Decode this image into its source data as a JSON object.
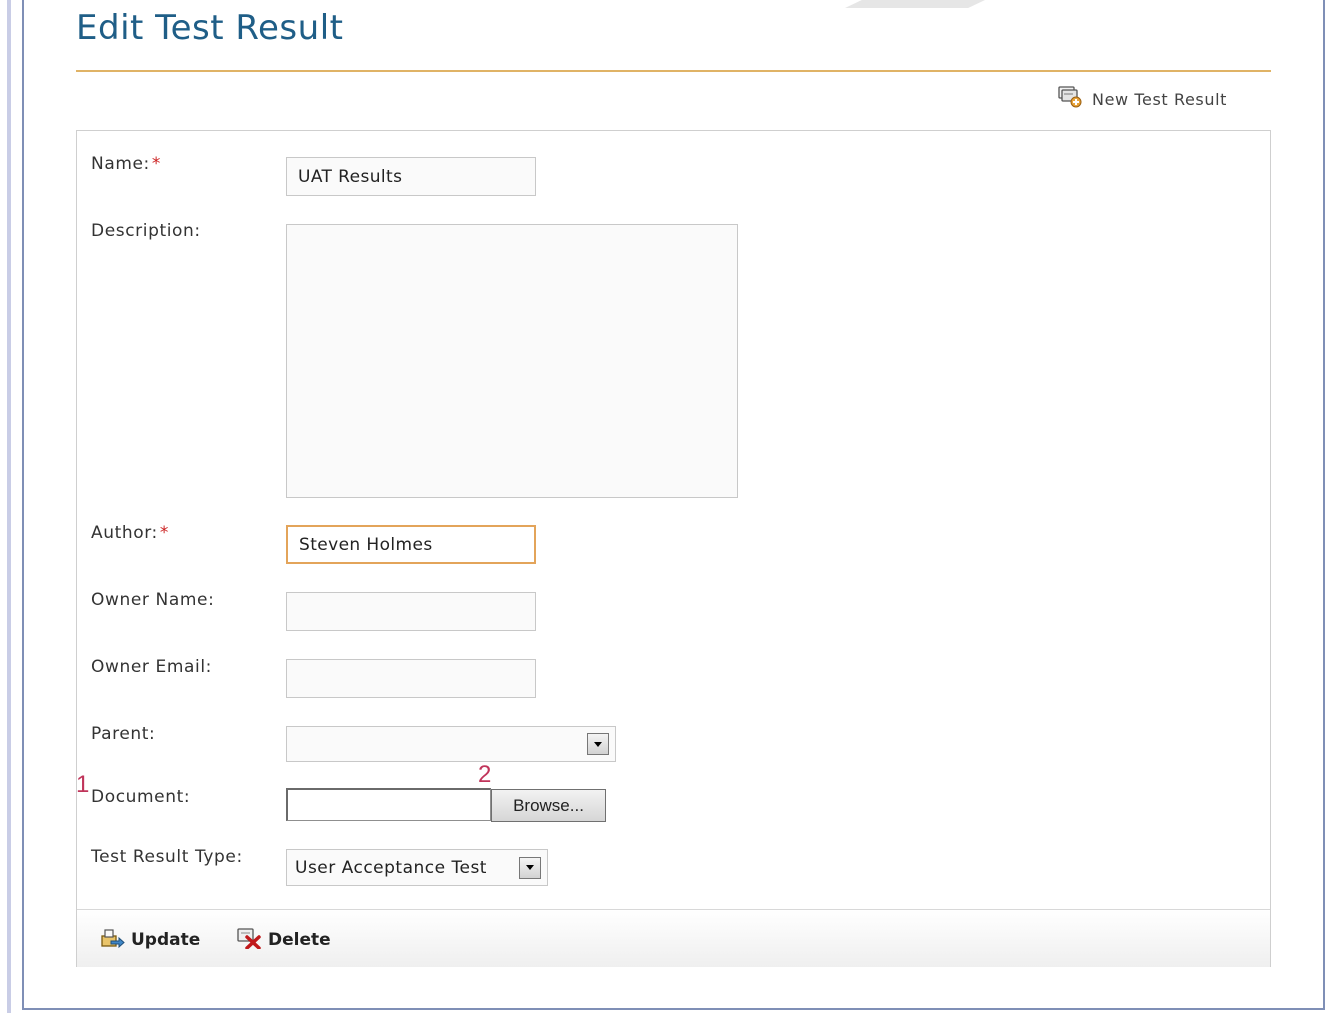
{
  "page": {
    "title": "Edit Test Result"
  },
  "header_actions": {
    "new_label": "New Test Result",
    "new_icon": "new-record-icon"
  },
  "form": {
    "name": {
      "label": "Name:",
      "required_mark": "*",
      "value": "UAT Results"
    },
    "description": {
      "label": "Description:",
      "value": ""
    },
    "author": {
      "label": "Author:",
      "required_mark": "*",
      "value": "Steven Holmes"
    },
    "owner_name": {
      "label": "Owner Name:",
      "value": ""
    },
    "owner_email": {
      "label": "Owner Email:",
      "value": ""
    },
    "parent": {
      "label": "Parent:",
      "selected": ""
    },
    "document": {
      "label": "Document:",
      "browse_label": "Browse...",
      "marker_1": "1",
      "marker_2": "2"
    },
    "test_result_type": {
      "label": "Test Result Type:",
      "selected": "User Acceptance Test"
    }
  },
  "footer": {
    "update_label": "Update",
    "update_icon": "update-icon",
    "delete_label": "Delete",
    "delete_icon": "delete-icon"
  },
  "colors": {
    "title": "#1f5e87",
    "rule": "#e0b366",
    "required": "#cc2222",
    "focus_border": "#e3a45a",
    "marker": "#c0345a"
  }
}
